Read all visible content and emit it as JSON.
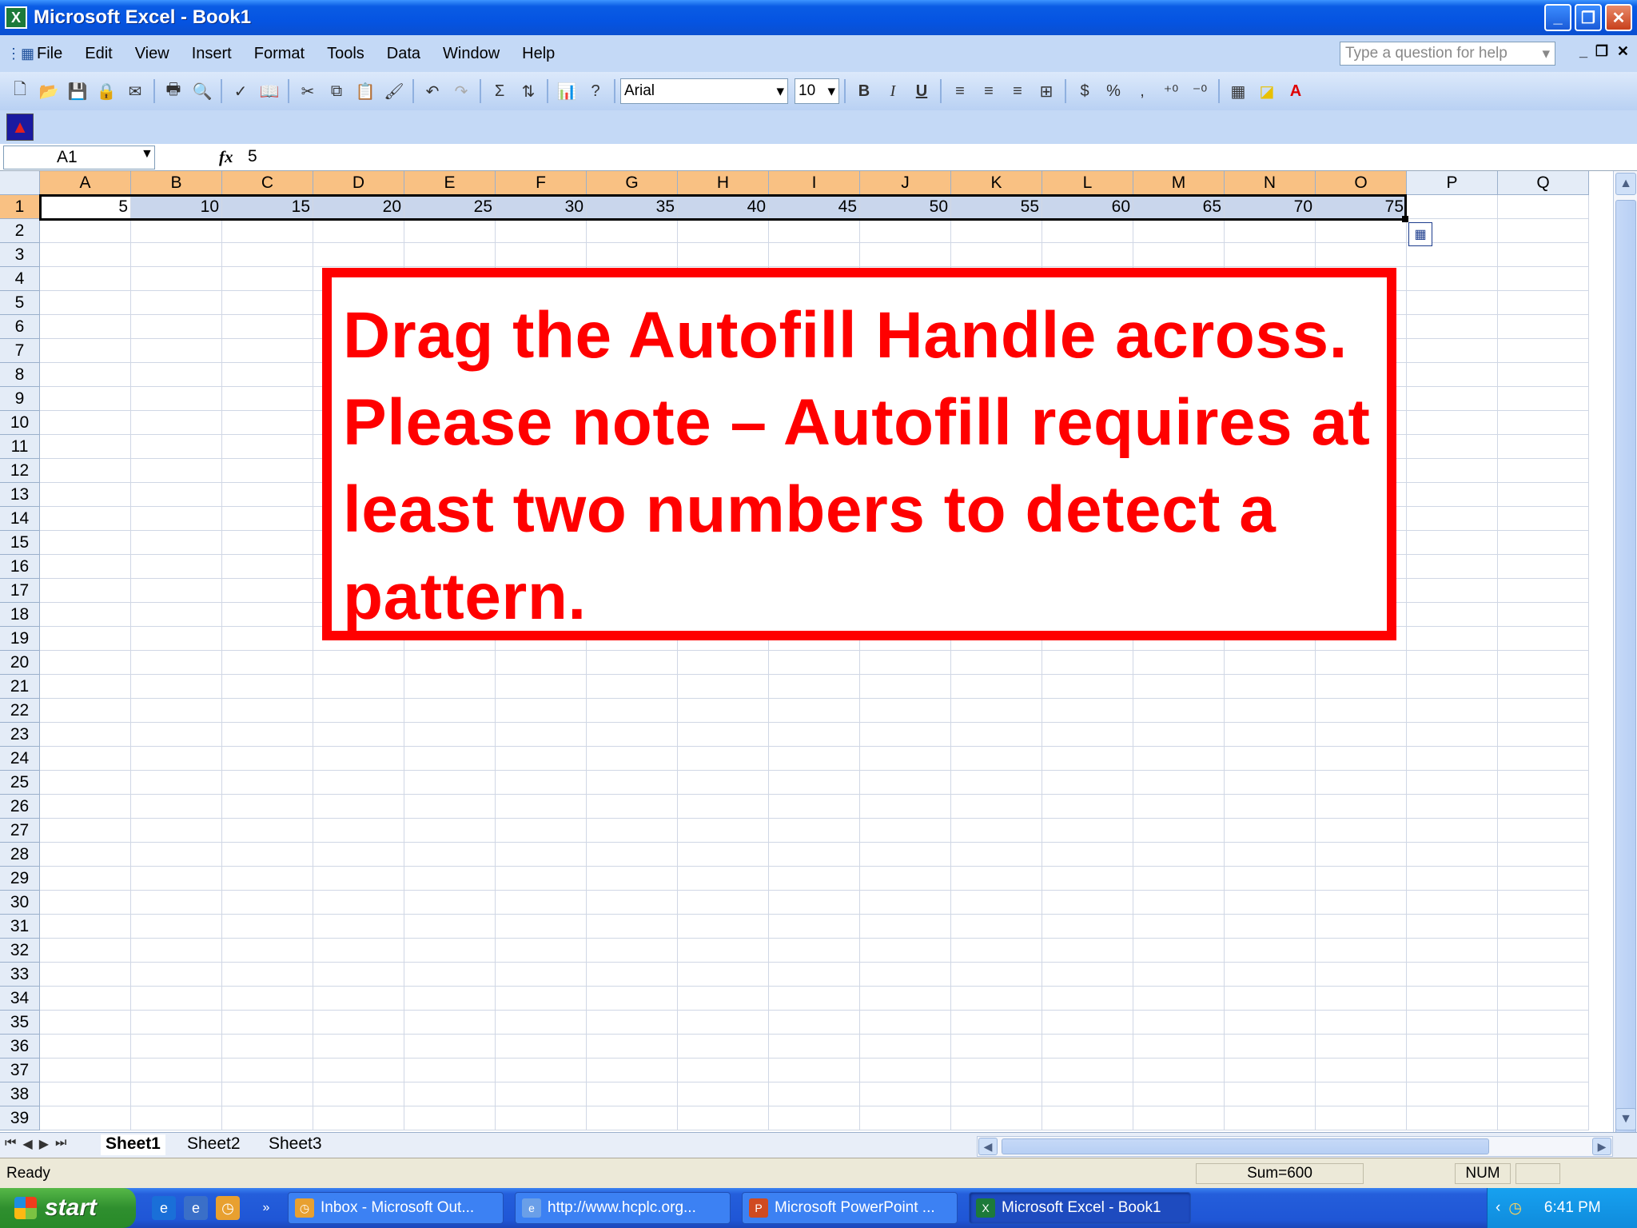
{
  "window": {
    "title": "Microsoft Excel - Book1",
    "app_icon": "X",
    "min": "_",
    "max": "❐",
    "close": "✕"
  },
  "menu": [
    "File",
    "Edit",
    "View",
    "Insert",
    "Format",
    "Tools",
    "Data",
    "Window",
    "Help"
  ],
  "help_box": {
    "placeholder": "Type a question for help"
  },
  "toolbar": {
    "font_name": "Arial",
    "font_size": "10",
    "bold": "B",
    "italic": "I",
    "underline": "U",
    "currency": "$",
    "percent": "%",
    "comma": ",",
    "sum": "Σ"
  },
  "formula_bar": {
    "name_box": "A1",
    "fx": "fx",
    "value": "5"
  },
  "columns": [
    "A",
    "B",
    "C",
    "D",
    "E",
    "F",
    "G",
    "H",
    "I",
    "J",
    "K",
    "L",
    "M",
    "N",
    "O",
    "P",
    "Q"
  ],
  "row_count": 39,
  "row1_values": [
    "5",
    "10",
    "15",
    "20",
    "25",
    "30",
    "35",
    "40",
    "45",
    "50",
    "55",
    "60",
    "65",
    "70",
    "75"
  ],
  "note_text": "Drag the Autofill Handle across.  Please note – Autofill requires at least two numbers to detect a pattern.",
  "sheet_tabs": [
    "Sheet1",
    "Sheet2",
    "Sheet3"
  ],
  "status": {
    "ready": "Ready",
    "sum": "Sum=600",
    "num": "NUM"
  },
  "taskbar": {
    "start": "start",
    "tasks": [
      "Inbox - Microsoft Out...",
      "http://www.hcplc.org...",
      "Microsoft PowerPoint ...",
      "Microsoft Excel - Book1"
    ],
    "clock": "6:41 PM"
  },
  "colors": {
    "accent_red": "#ff0000",
    "header_orange": "#f9c183",
    "selection": "#c9d6ec"
  }
}
